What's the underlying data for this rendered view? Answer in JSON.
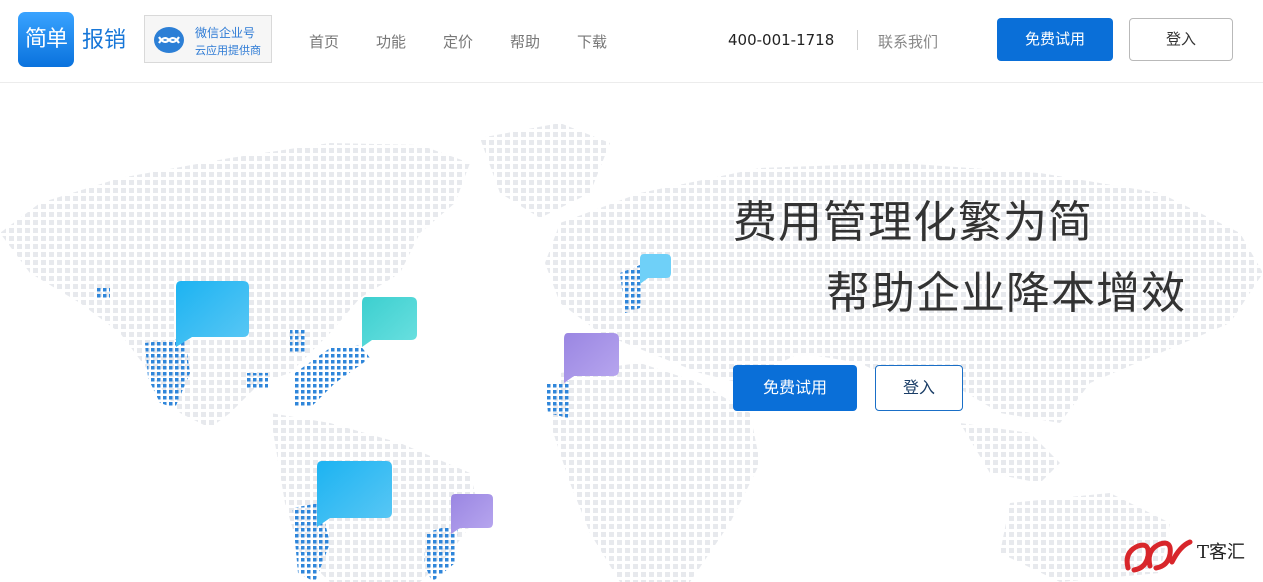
{
  "header": {
    "logo_mark": "简单",
    "logo_text": "报销",
    "badge_line1": "微信企业号",
    "badge_line2": "云应用提供商",
    "nav": [
      "首页",
      "功能",
      "定价",
      "帮助",
      "下载"
    ],
    "phone": "400-001-1718",
    "contact": "联系我们",
    "try_label": "免费试用",
    "login_label": "登入"
  },
  "hero": {
    "title_line1": "费用管理化繁为简",
    "title_line2": "帮助企业降本增效",
    "try_label": "免费试用",
    "login_label": "登入"
  },
  "watermark": {
    "text": "T客汇"
  },
  "colors": {
    "primary": "#0a6fd8",
    "map_dot": "#e6e8ec",
    "map_dot_blue": "#2f86da"
  }
}
